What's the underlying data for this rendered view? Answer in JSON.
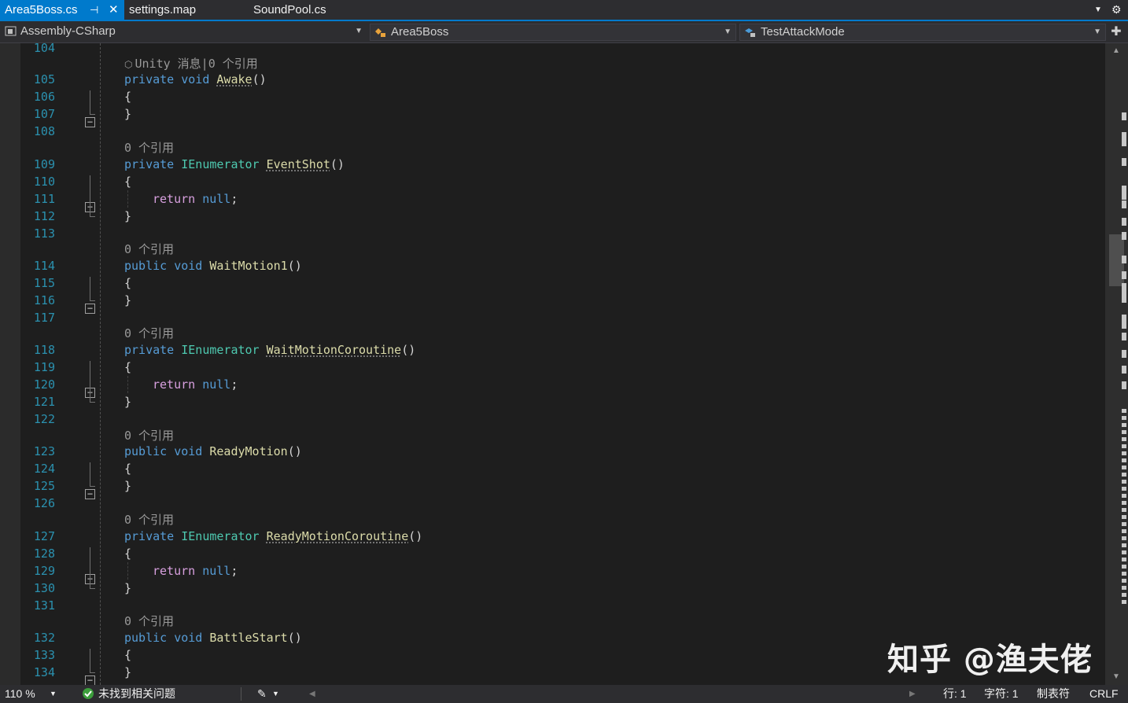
{
  "tabs": [
    {
      "label": "Area5Boss.cs",
      "active": true,
      "pin_icon": "pin-icon",
      "close_icon": "close-icon"
    },
    {
      "label": "settings.map",
      "active": false
    },
    {
      "label": "SoundPool.cs",
      "active": false
    }
  ],
  "tabbar_icons": [
    "dropdown-arrow-icon",
    "gear-icon"
  ],
  "navbar": {
    "project": "Assembly-CSharp",
    "class": "Area5Boss",
    "member": "TestAttackMode"
  },
  "colors": {
    "accent": "#007acc",
    "keyword": "#569cd6",
    "control_keyword": "#d8a0df",
    "type": "#4ec9b0",
    "method": "#dcdcaa",
    "line_number": "#2b91af",
    "codelens": "#999999"
  },
  "editor": {
    "codelens_unity": "Unity 消息|0 个引用",
    "codelens_ref": "0 个引用",
    "line_numbers": [
      "104",
      "105",
      "106",
      "107",
      "108",
      "109",
      "110",
      "111",
      "112",
      "113",
      "114",
      "115",
      "116",
      "117",
      "118",
      "119",
      "120",
      "121",
      "122",
      "123",
      "124",
      "125",
      "126",
      "127",
      "128",
      "129",
      "130",
      "131",
      "132",
      "133",
      "134"
    ],
    "tokens": {
      "private": "private",
      "public": "public",
      "void": "void",
      "ienumerator": "IEnumerator",
      "return": "return",
      "null": "null",
      "semicolon": ";",
      "open_brace": "{",
      "close_brace": "}",
      "parens": "()",
      "fold_minus": "−"
    },
    "methods": [
      "Awake",
      "EventShot",
      "WaitMotion1",
      "WaitMotionCoroutine",
      "ReadyMotion",
      "ReadyMotionCoroutine",
      "BattleStart"
    ]
  },
  "watermark": "知乎 @渔夫佬",
  "statusbar": {
    "zoom": "110 %",
    "issues": "未找到相关问题",
    "line": "行: 1",
    "char": "字符: 1",
    "indent": "制表符",
    "eol": "CRLF"
  }
}
